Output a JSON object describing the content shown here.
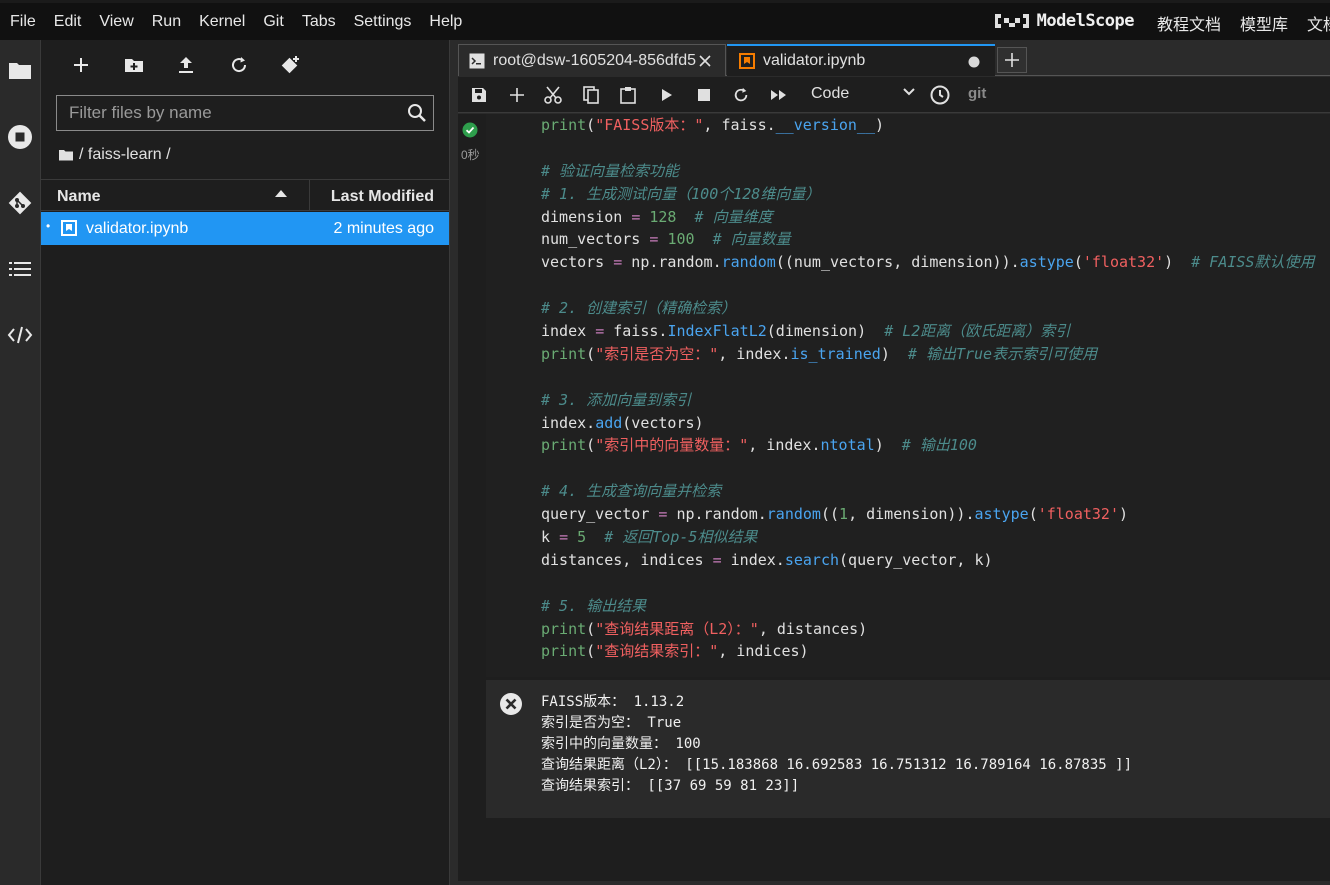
{
  "menubar": {
    "items": [
      "File",
      "Edit",
      "View",
      "Run",
      "Kernel",
      "Git",
      "Tabs",
      "Settings",
      "Help"
    ],
    "brand": "ModelScope",
    "links": [
      "教程文档",
      "模型库",
      "文档"
    ]
  },
  "filebrowser": {
    "filter_placeholder": "Filter files by name",
    "breadcrumb": "/ faiss-learn /",
    "col_name": "Name",
    "col_modified": "Last Modified",
    "files": [
      {
        "name": "validator.ipynb",
        "modified": "2 minutes ago"
      }
    ]
  },
  "tabs": [
    {
      "label": "root@dsw-1605204-856dfd5"
    },
    {
      "label": "validator.ipynb"
    }
  ],
  "notebook_toolbar": {
    "cell_type": "Code",
    "git_label": "git"
  },
  "cell": {
    "exec_time": "0秒",
    "code_lines": [
      "print(\"FAISS版本：\", faiss.__version__)",
      "",
      "# 验证向量检索功能",
      "# 1. 生成测试向量（100个128维向量）",
      "dimension = 128  # 向量维度",
      "num_vectors = 100  # 向量数量",
      "vectors = np.random.random((num_vectors, dimension)).astype('float32')  # FAISS默认使用",
      "",
      "# 2. 创建索引（精确检索）",
      "index = faiss.IndexFlatL2(dimension)  # L2距离（欧氏距离）索引",
      "print(\"索引是否为空：\", index.is_trained)  # 输出True表示索引可使用",
      "",
      "# 3. 添加向量到索引",
      "index.add(vectors)",
      "print(\"索引中的向量数量：\", index.ntotal)  # 输出100",
      "",
      "# 4. 生成查询向量并检索",
      "query_vector = np.random.random((1, dimension)).astype('float32')",
      "k = 5  # 返回Top-5相似结果",
      "distances, indices = index.search(query_vector, k)",
      "",
      "# 5. 输出结果",
      "print(\"查询结果距离（L2）：\", distances)",
      "print(\"查询结果索引：\", indices)"
    ],
    "output_lines": [
      "FAISS版本： 1.13.2",
      "索引是否为空： True",
      "索引中的向量数量： 100",
      "查询结果距离（L2）： [[15.183868 16.692583 16.751312 16.789164 16.87835 ]]",
      "查询结果索引： [[37 69 59 81 23]]"
    ]
  }
}
